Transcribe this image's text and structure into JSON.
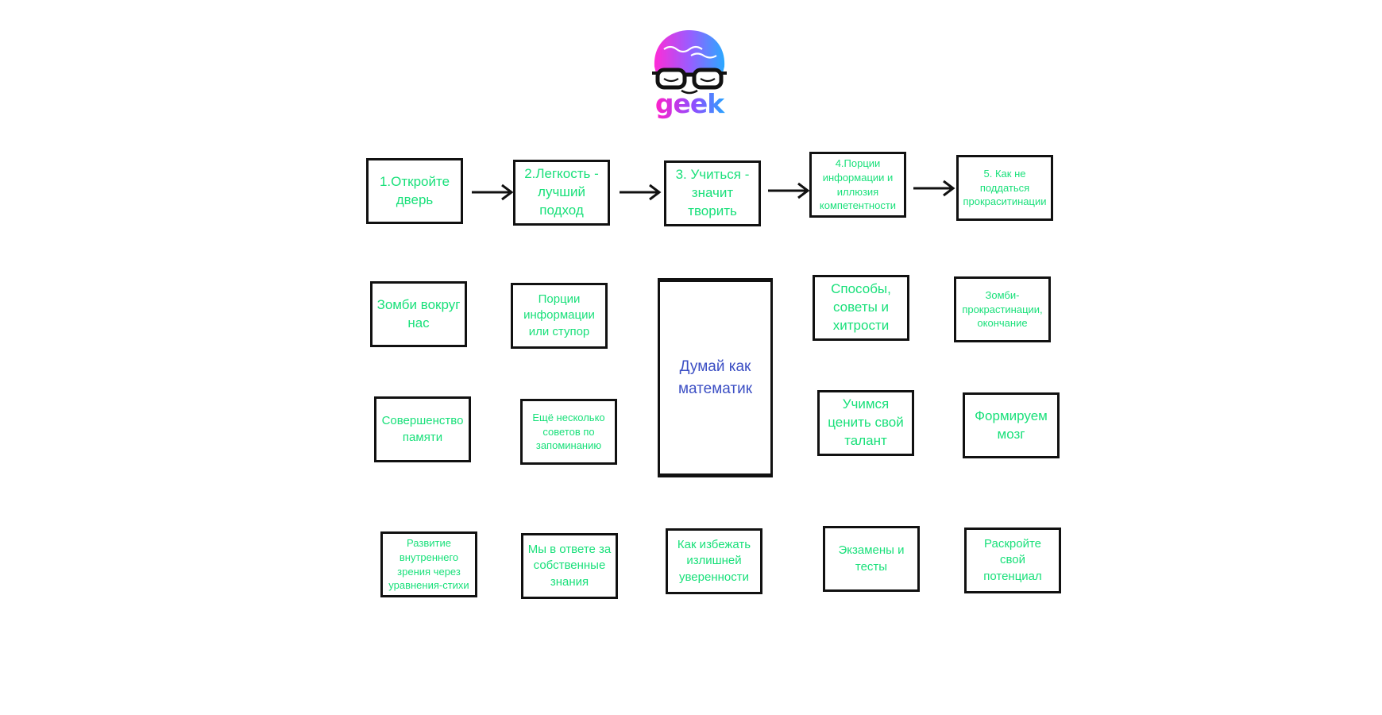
{
  "logo": {
    "text": "geek",
    "colors": {
      "cap_start": "#ff2bd6",
      "cap_end": "#2aa9ff",
      "text_start": "#ff20c9",
      "text_end": "#27a5ff"
    }
  },
  "colors": {
    "box_text": "#19e07a",
    "center_text": "#3c4fc4",
    "border": "#111111"
  },
  "steps": [
    {
      "label": "1.Откройте дверь"
    },
    {
      "label": "2.Легкость - лучший подход"
    },
    {
      "label": "3. Учиться - значит творить"
    },
    {
      "label": "4.Порции информации и иллюзия компетентности"
    },
    {
      "label": "5. Как не поддаться прокраситинации"
    }
  ],
  "grid": {
    "row1": [
      {
        "label": "Зомби вокруг нас"
      },
      {
        "label": "Порции информации или ступор"
      },
      {
        "label": "Способы, советы и хитрости"
      },
      {
        "label": "Зомби-прокрастинации, окончание"
      }
    ],
    "row2": [
      {
        "label": "Совершенство памяти"
      },
      {
        "label": "Ещё несколько советов по запоминанию"
      },
      {
        "label": "Учимся ценить свой талант"
      },
      {
        "label": "Формируем мозг"
      }
    ],
    "row3": [
      {
        "label": "Развитие внутреннего зрения через уравнения-стихи"
      },
      {
        "label": "Мы в ответе за собственные знания"
      },
      {
        "label": "Как избежать излишней уверенности"
      },
      {
        "label": "Экзамены и тесты"
      },
      {
        "label": "Раскройте свой потенциал"
      }
    ]
  },
  "center": {
    "label": "Думай как математик"
  }
}
